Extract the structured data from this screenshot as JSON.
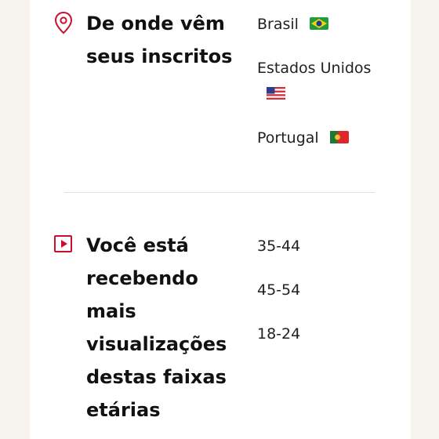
{
  "locations": {
    "heading": "De onde vêm seus inscritos",
    "icon": "location-pin-icon",
    "countries": [
      {
        "name": "Brasil",
        "flag": "brazil-flag-icon"
      },
      {
        "name": "Estados Unidos",
        "flag": "usa-flag-icon"
      },
      {
        "name": "Portugal",
        "flag": "portugal-flag-icon"
      }
    ]
  },
  "ages": {
    "heading": "Você está recebendo mais visualizações destas faixas etárias",
    "icon": "play-icon",
    "ranges": [
      "35-44",
      "45-54",
      "18-24"
    ]
  },
  "colors": {
    "accent": "#c8102e",
    "background": "#f6f3ef",
    "card": "#ffffff"
  }
}
